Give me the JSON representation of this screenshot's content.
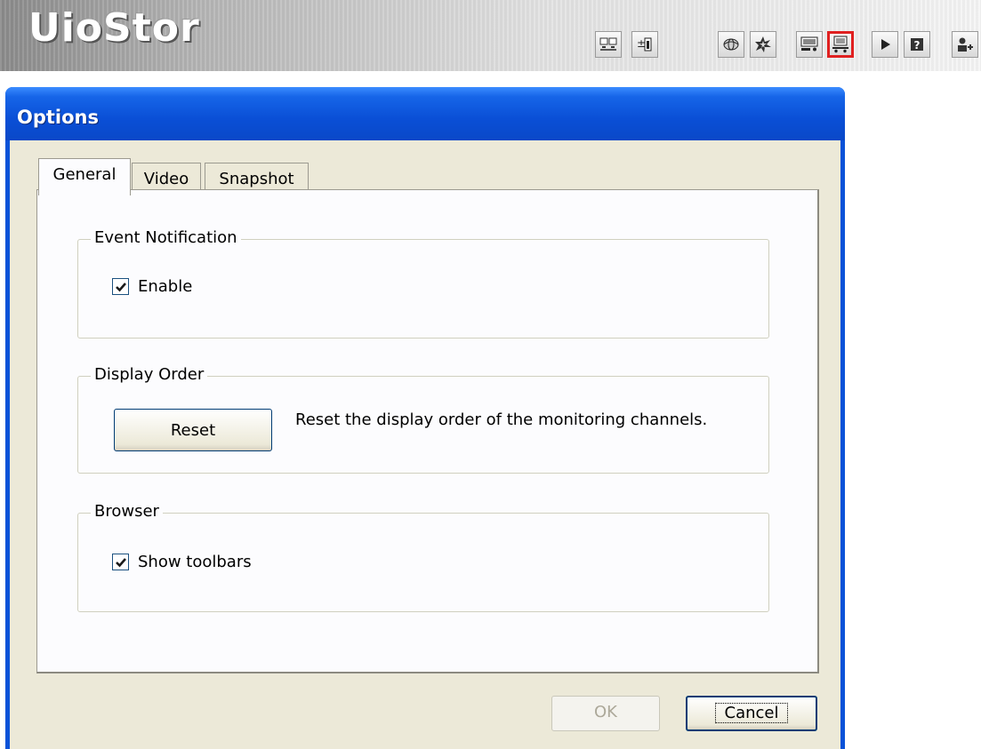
{
  "app": {
    "logo_text": "UioStor",
    "toolbar_icons": [
      "monitor-layout-icon",
      "pan-tilt-icon",
      "globe-icon",
      "burst-icon",
      "video-settings-icon",
      "options-icon",
      "play-icon",
      "help-icon",
      "user-add-icon"
    ],
    "active_toolbar_icon": "options-icon"
  },
  "dialog": {
    "title": "Options",
    "tabs": [
      {
        "label": "General",
        "active": true
      },
      {
        "label": "Video",
        "active": false
      },
      {
        "label": "Snapshot",
        "active": false
      }
    ],
    "event_notification": {
      "legend": "Event Notification",
      "enable_label": "Enable",
      "enable_checked": true
    },
    "display_order": {
      "legend": "Display Order",
      "reset_label": "Reset",
      "description": "Reset the display order of the monitoring channels."
    },
    "browser": {
      "legend": "Browser",
      "show_toolbars_label": "Show toolbars",
      "show_toolbars_checked": true
    },
    "ok_label": "OK",
    "ok_enabled": false,
    "cancel_label": "Cancel"
  },
  "colors": {
    "titlebar": "#0a52d8",
    "dialog_face": "#ece9d8",
    "active_highlight": "#e02020"
  }
}
